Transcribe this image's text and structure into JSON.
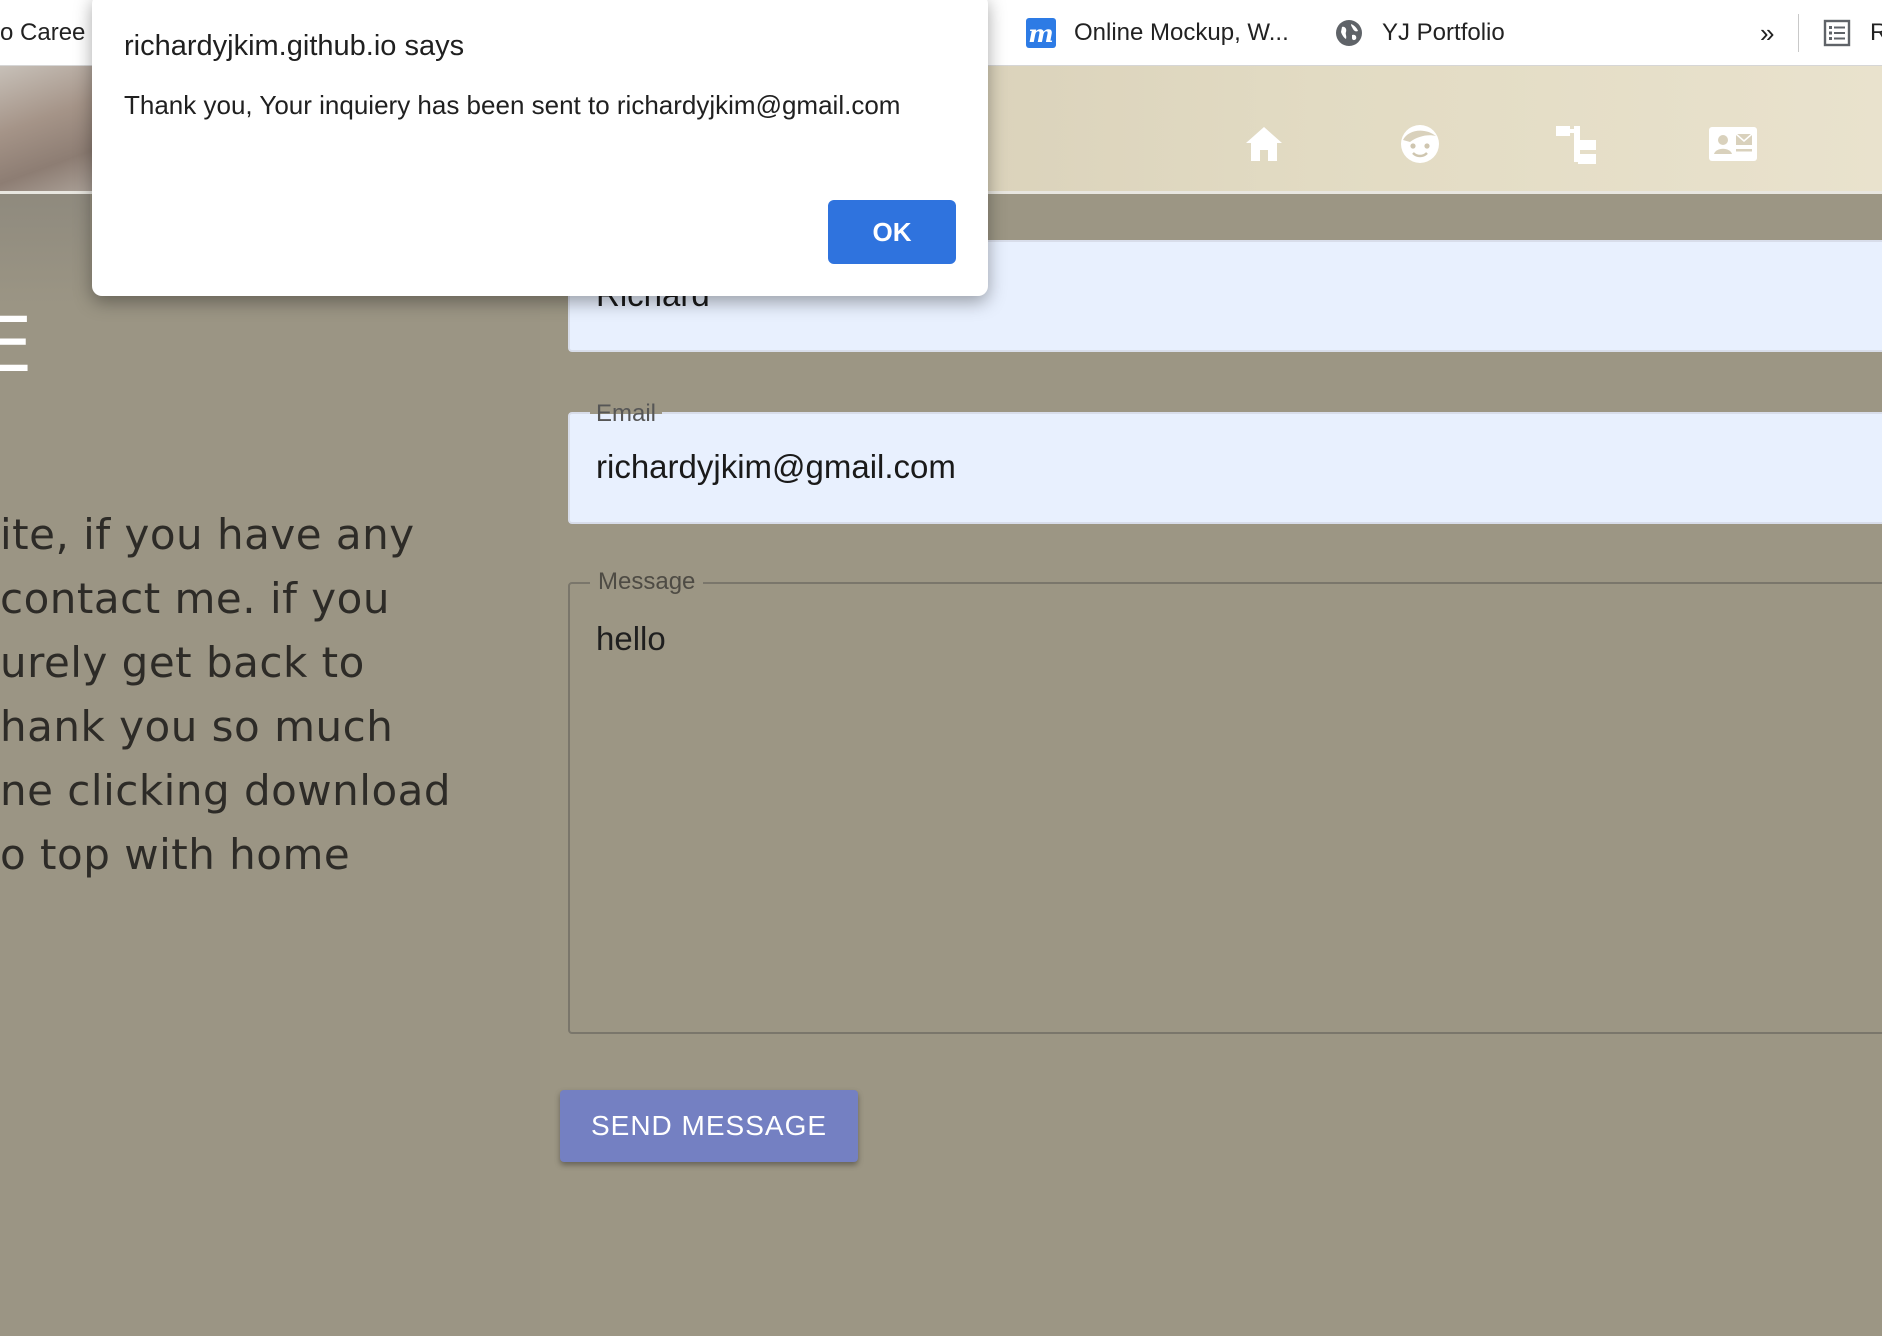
{
  "bookmarks": {
    "items": [
      {
        "label": "o Caree",
        "icon": "none"
      },
      {
        "label": ".",
        "icon": "none"
      },
      {
        "label": "Online Mockup, W...",
        "icon": "moqups-m-icon"
      },
      {
        "label": "YJ Portfolio",
        "icon": "globe-icon"
      }
    ],
    "overflow": "»",
    "reading_list_initial": "R"
  },
  "nav": {
    "icons": [
      "home-icon",
      "face-icon",
      "sitemap-icon",
      "contact-card-icon"
    ]
  },
  "left": {
    "title": "IE",
    "lines": [
      "ite, if you have any",
      " contact me. if you",
      "urely get back to",
      "hank you so much",
      "ne clicking download",
      "o top with home"
    ]
  },
  "form": {
    "name_value": "Richard",
    "email_label": "Email",
    "email_value": "richardyjkim@gmail.com",
    "message_label": "Message",
    "message_value": "hello",
    "send_label": "SEND MESSAGE"
  },
  "alert": {
    "title": "richardyjkim.github.io says",
    "message": "Thank you, Your inquiery has been sent to richardyjkim@gmail.com",
    "ok_label": "OK"
  },
  "colors": {
    "background": "#9c9684",
    "autofill": "#e8f0fe",
    "send_button": "#7480c2",
    "ok_button": "#2f73de"
  }
}
